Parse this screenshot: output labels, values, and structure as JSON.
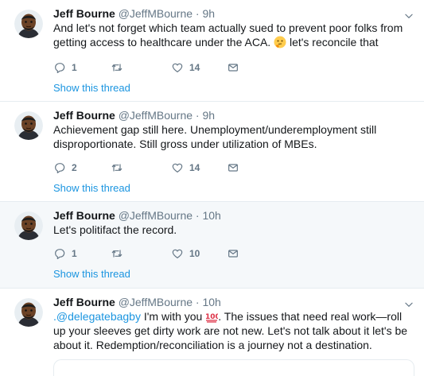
{
  "tweets": [
    {
      "name": "Jeff Bourne",
      "handle": "@JeffMBourne",
      "time": "· 9h",
      "text_a": "And let's not forget which team actually sued to prevent poor folks from getting access to healthcare under the ACA. ",
      "text_b": " let's reconcile that",
      "reply_count": "1",
      "retweet_count": "",
      "like_count": "14",
      "show_thread": "Show this thread"
    },
    {
      "name": "Jeff Bourne",
      "handle": "@JeffMBourne",
      "time": "· 9h",
      "text": "Achievement gap still here. Unemployment/underemployment still disproportionate. Still gross under utilization of MBEs.",
      "reply_count": "2",
      "retweet_count": "",
      "like_count": "14",
      "show_thread": "Show this thread"
    },
    {
      "name": "Jeff Bourne",
      "handle": "@JeffMBourne",
      "time": "· 10h",
      "text": "Let's politifact the record.",
      "reply_count": "1",
      "retweet_count": "",
      "like_count": "10",
      "show_thread": "Show this thread"
    },
    {
      "name": "Jeff Bourne",
      "handle": "@JeffMBourne",
      "time": "· 10h",
      "mention": ".@delegatebagby",
      "text_a": " I'm with you ",
      "text_b": ". The issues that need real work—roll up your sleeves get dirty work are not new.  Let's not talk about it let's be about it. Redemption/reconciliation is a journey not a destination."
    }
  ],
  "icons": {
    "reply": "reply-icon",
    "retweet": "retweet-icon",
    "like": "heart-icon",
    "dm": "envelope-icon",
    "caret": "chevron-down-icon",
    "thinking": "thinking-face-emoji",
    "hundred": "hundred-points-emoji"
  },
  "colors": {
    "accent": "#1b95e0",
    "muted": "#657786",
    "highlight_bg": "#f5f8fa",
    "divider": "#e6ecf0"
  }
}
